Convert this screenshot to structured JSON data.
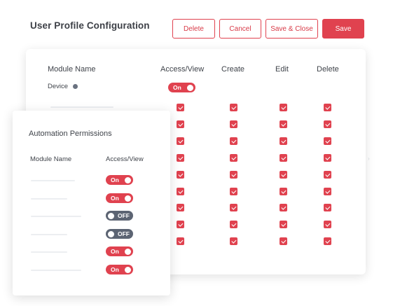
{
  "header": {
    "title": "User Profile Configuration",
    "buttons": {
      "delete": "Delete",
      "cancel": "Cancel",
      "save_close": "Save & Close",
      "save": "Save"
    }
  },
  "main": {
    "columns": [
      "Module Name",
      "Access/View",
      "Create",
      "Edit",
      "Delete"
    ],
    "device": {
      "label": "Device",
      "toggle": "On",
      "toggle_state": true
    },
    "permission_rows": [
      [
        true,
        true,
        true,
        true
      ],
      [
        true,
        true,
        true,
        true
      ],
      [
        true,
        true,
        true,
        true
      ],
      [
        true,
        true,
        true,
        true
      ],
      [
        true,
        true,
        true,
        true
      ],
      [
        true,
        true,
        true,
        true
      ],
      [
        true,
        true,
        true,
        true
      ],
      [
        true,
        true,
        true,
        true
      ],
      [
        true,
        true,
        true,
        true
      ]
    ]
  },
  "automation": {
    "title": "Automation Permissions",
    "col_module": "Module Name",
    "col_access": "Access/View",
    "rows": [
      {
        "state": "On",
        "enabled": true
      },
      {
        "state": "On",
        "enabled": true
      },
      {
        "state": "OFF",
        "enabled": false
      },
      {
        "state": "OFF",
        "enabled": false
      },
      {
        "state": "On",
        "enabled": true
      },
      {
        "state": "On",
        "enabled": true
      }
    ]
  },
  "colors": {
    "accent": "#e0424f",
    "toggle_off": "#5c6473",
    "text": "#3f434a"
  }
}
